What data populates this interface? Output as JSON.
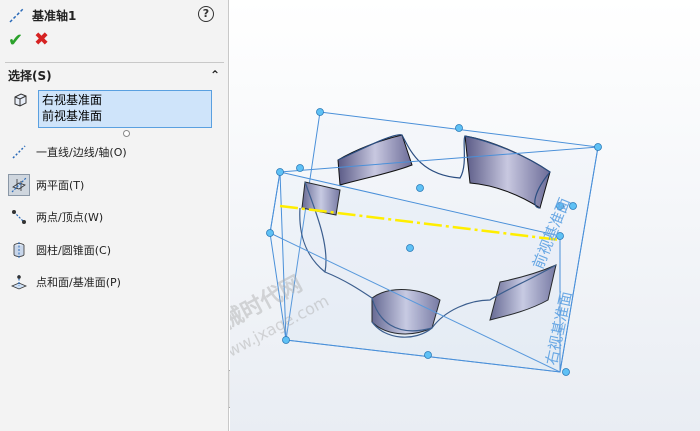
{
  "feature": {
    "title": "基准轴1",
    "help": "?"
  },
  "actions": {
    "ok_icon": "checkmark-icon",
    "cancel_icon": "x-icon"
  },
  "selection": {
    "header": "选择(S)",
    "items": [
      "右视基准面",
      "前视基准面"
    ]
  },
  "options": [
    {
      "icon": "line-edge-axis-icon",
      "label_main": "一直线/边线/轴",
      "label_key": "(O)",
      "selected": false
    },
    {
      "icon": "two-planes-icon",
      "label_main": "两平面",
      "label_key": "(T)",
      "selected": true
    },
    {
      "icon": "two-points-icon",
      "label_main": "两点/顶点",
      "label_key": "(W)",
      "selected": false
    },
    {
      "icon": "cylinder-cone-icon",
      "label_main": "圆柱/圆锥面",
      "label_key": "(C)",
      "selected": false
    },
    {
      "icon": "point-face-icon",
      "label_main": "点和面/基准面",
      "label_key": "(P)",
      "selected": false
    }
  ],
  "viewport": {
    "plane_labels": [
      "前视基准面",
      "右视基准面"
    ],
    "watermark_cn": "机械时代网",
    "watermark_url": "www.jxage.com",
    "colors": {
      "plane": "#4a90d9",
      "axis": "#ffee00",
      "part": "#6f6fa0"
    }
  }
}
